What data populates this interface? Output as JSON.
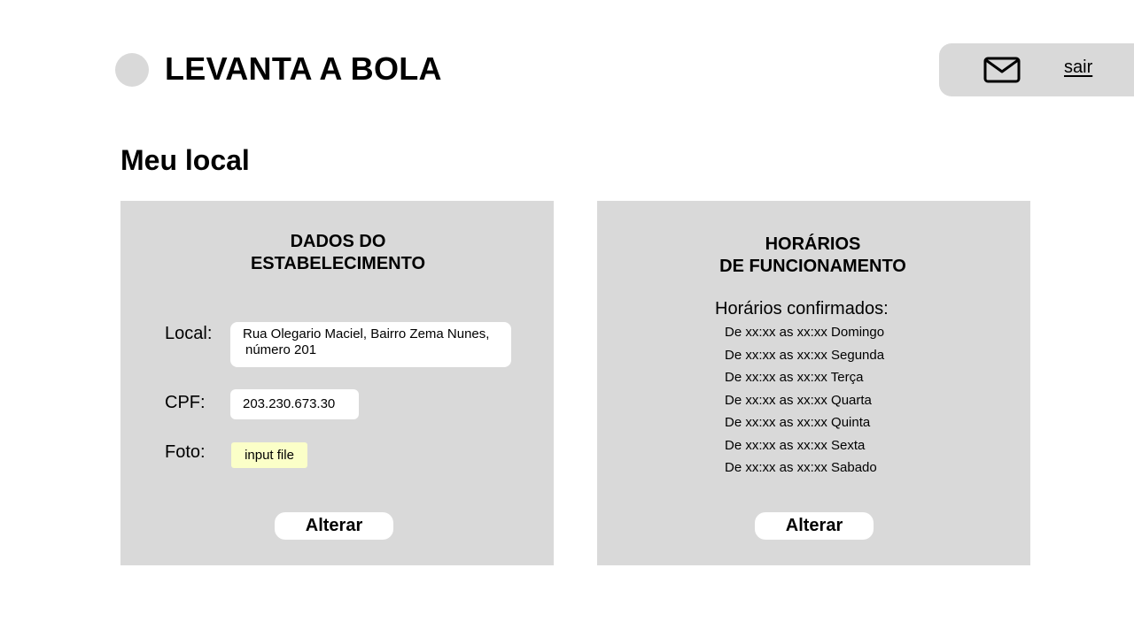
{
  "header": {
    "app_title": "LEVANTA A BOLA",
    "mail_icon": "mail-icon",
    "logout_label": "sair"
  },
  "page": {
    "title": "Meu local"
  },
  "establishment": {
    "heading_line1": "DADOS DO",
    "heading_line2": "ESTABELECIMENTO",
    "local_label": "Local:",
    "local_value_line1": "Rua Olegario Maciel, Bairro Zema Nunes,",
    "local_value_line2": "número 201",
    "cpf_label": "CPF:",
    "cpf_value": "203.230.673.30",
    "photo_label": "Foto:",
    "photo_input_label": "input file",
    "alter_button": "Alterar"
  },
  "hours": {
    "heading_line1": "HORÁRIOS",
    "heading_line2": "DE FUNCIONAMENTO",
    "confirmed_label": "Horários confirmados:",
    "schedule": [
      "De xx:xx as xx:xx Domingo",
      "De xx:xx as xx:xx Segunda",
      "De xx:xx as xx:xx Terça",
      "De xx:xx as xx:xx Quarta",
      "De xx:xx as xx:xx Quinta",
      "De xx:xx as xx:xx Sexta",
      "De xx:xx as xx:xx Sabado"
    ],
    "alter_button": "Alterar"
  },
  "colors": {
    "panel_bg": "#d9d9d9",
    "file_input_bg": "#fbffc8",
    "text": "#000000",
    "background": "#ffffff"
  }
}
